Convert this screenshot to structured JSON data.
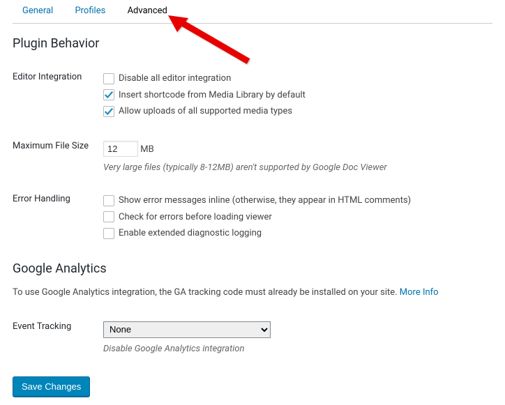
{
  "tabs": {
    "general": "General",
    "profiles": "Profiles",
    "advanced": "Advanced"
  },
  "sections": {
    "plugin_behavior_title": "Plugin Behavior",
    "google_analytics_title": "Google Analytics"
  },
  "editor_integration": {
    "label": "Editor Integration",
    "opt_disable": "Disable all editor integration",
    "opt_insert_shortcode": "Insert shortcode from Media Library by default",
    "opt_allow_uploads": "Allow uploads of all supported media types"
  },
  "max_file_size": {
    "label": "Maximum File Size",
    "value": "12",
    "unit": "MB",
    "description": "Very large files (typically 8-12MB) aren't supported by Google Doc Viewer"
  },
  "error_handling": {
    "label": "Error Handling",
    "opt_inline": "Show error messages inline (otherwise, they appear in HTML comments)",
    "opt_check": "Check for errors before loading viewer",
    "opt_diag": "Enable extended diagnostic logging"
  },
  "ga": {
    "intro_text": "To use Google Analytics integration, the GA tracking code must already be installed on your site. ",
    "more_info": "More Info",
    "event_tracking_label": "Event Tracking",
    "select_value": "None",
    "select_desc": "Disable Google Analytics integration"
  },
  "save_button": "Save Changes"
}
